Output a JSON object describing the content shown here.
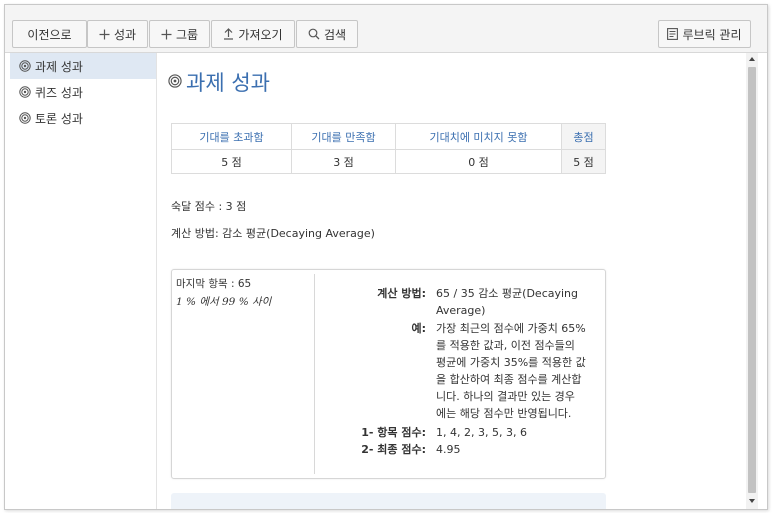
{
  "toolbar": {
    "back_label": "이전으로",
    "outcome_label": "성과",
    "group_label": "그룹",
    "import_label": "가져오기",
    "search_label": "검색",
    "rubric_label": "루브릭 관리"
  },
  "sidebar": {
    "items": [
      {
        "label": "과제 성과",
        "active": true
      },
      {
        "label": "퀴즈 성과",
        "active": false
      },
      {
        "label": "토론 성과",
        "active": false
      }
    ]
  },
  "main": {
    "title": "과제 성과",
    "levels": {
      "headers": [
        "기대를 초과함",
        "기대를 만족함",
        "기대치에 미치지 못함",
        "총점"
      ],
      "values": [
        "5 점",
        "3 점",
        "0 점",
        "5 점"
      ]
    },
    "mastery": "숙달 점수 : 3 점",
    "calc_method_line": "계산 방법: 감소 평균(Decaying Average)",
    "calc_box": {
      "left_line1": "마지막 항목 : 65",
      "left_line2": "1 % 에서 99 % 사이",
      "method_key": "계산 방법:",
      "method_val_1": "65 / 35 감소 평균(Decaying",
      "method_val_2": "Average)",
      "example_key": "예:",
      "example_lines": [
        "가장 최근의 점수에 가중치 65%",
        "를 적용한 값과, 이전 점수들의",
        "평균에 가중치 35%를 적용한 값",
        "을 합산하여 최종 점수를 계산합",
        "니다. 하나의 결과만 있는 경우",
        "에는 해당 점수만 반영됩니다."
      ],
      "item_scores_key": "1- 항목 점수:",
      "item_scores_val": "1, 4, 2, 3, 5, 3, 6",
      "final_score_key": "2- 최종 점수:",
      "final_score_val": "4.95"
    }
  },
  "colors": {
    "accent": "#3b6fb0",
    "active_bg": "#dfe8f3"
  }
}
